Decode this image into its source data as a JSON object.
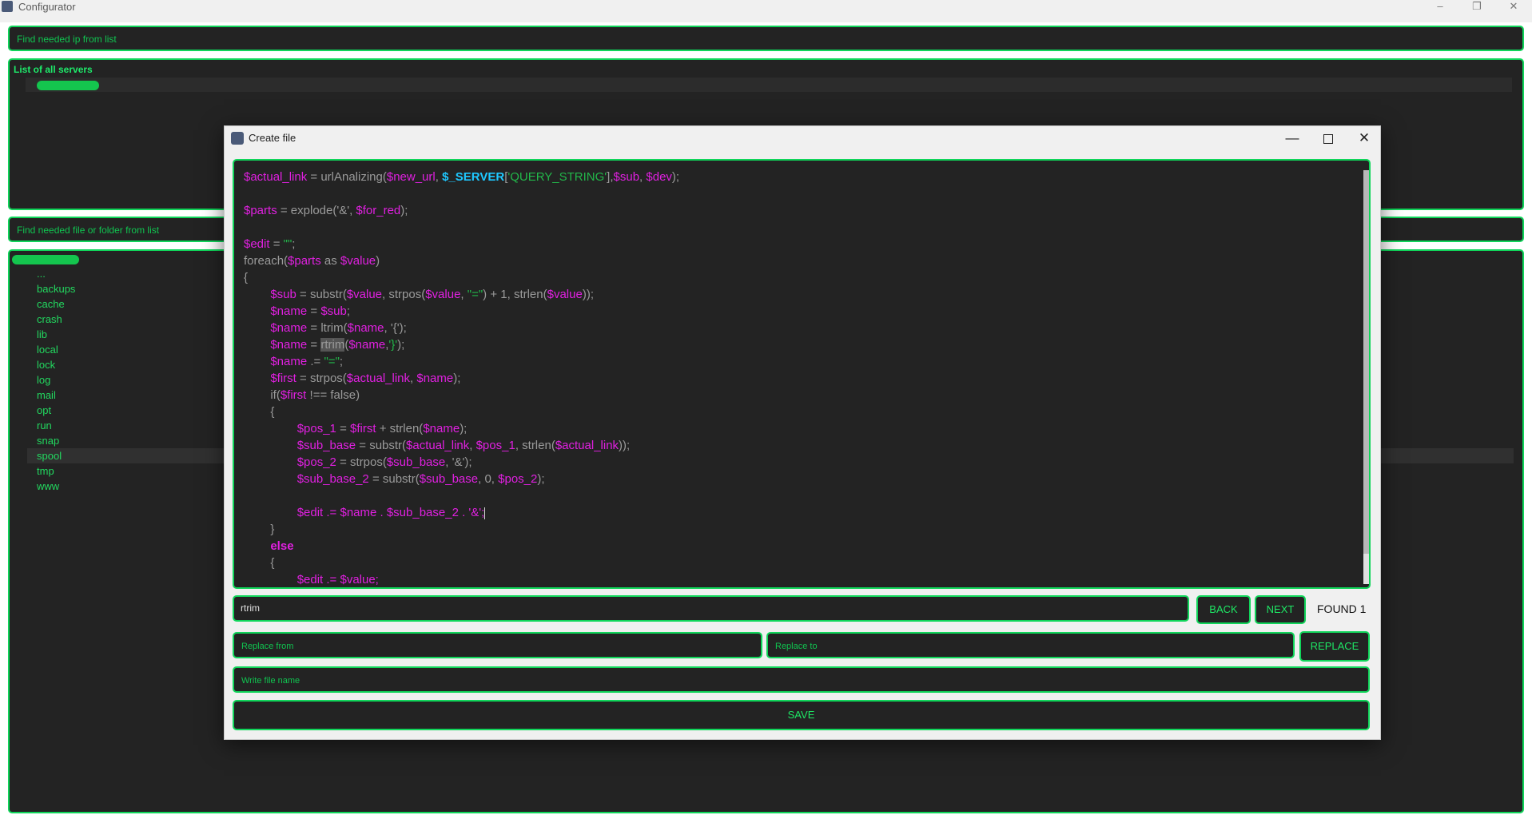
{
  "window": {
    "title": "Configurator",
    "controls": [
      "–",
      "❐",
      "✕"
    ]
  },
  "ip_search": {
    "placeholder": "Find needed ip from list"
  },
  "servers": {
    "title": "List of all servers"
  },
  "file_search": {
    "placeholder": "Find needed file or folder from list"
  },
  "files": {
    "items": [
      "...",
      "backups",
      "cache",
      "crash",
      "lib",
      "local",
      "lock",
      "log",
      "mail",
      "opt",
      "run",
      "snap",
      "spool",
      "tmp",
      "www"
    ],
    "selected": "spool"
  },
  "dialog": {
    "title": "Create file",
    "controls": [
      "—",
      "",
      "✕"
    ],
    "search_value": "rtrim",
    "back_label": "BACK",
    "next_label": "NEXT",
    "found_label": "FOUND 1",
    "replace_from_placeholder": "Replace from",
    "replace_to_placeholder": "Replace to",
    "replace_label": "REPLACE",
    "filename_placeholder": "Write file name",
    "save_label": "SAVE"
  },
  "colors": {
    "accent_green": "#10d55a",
    "panel_dark": "#232323",
    "code_variable": "#e020e0",
    "code_function": "#9a9a9a",
    "code_string": "#22b84a",
    "code_superglobal": "#1ec8ff"
  },
  "code_lines": [
    [
      [
        "v",
        "$actual_link"
      ],
      [
        "f",
        " = urlAnalizing("
      ],
      [
        "v",
        "$new_url"
      ],
      [
        "f",
        ", "
      ],
      [
        "cyan",
        "$_SERVER"
      ],
      [
        "f",
        "["
      ],
      [
        "s",
        "'QUERY_STRING'"
      ],
      [
        "f",
        "],"
      ],
      [
        "v",
        "$sub"
      ],
      [
        "f",
        ", "
      ],
      [
        "v",
        "$dev"
      ],
      [
        "f",
        ");"
      ]
    ],
    [],
    [
      [
        "v",
        "$parts"
      ],
      [
        "f",
        " = explode('&', "
      ],
      [
        "v",
        "$for_red"
      ],
      [
        "f",
        ");"
      ]
    ],
    [],
    [
      [
        "v",
        "$edit"
      ],
      [
        "f",
        " = "
      ],
      [
        "s",
        "\"\""
      ],
      [
        "f",
        ";"
      ]
    ],
    [
      [
        "f",
        "foreach("
      ],
      [
        "v",
        "$parts"
      ],
      [
        "f",
        " as "
      ],
      [
        "v",
        "$value"
      ],
      [
        "f",
        ")"
      ]
    ],
    [
      [
        "f",
        "{"
      ]
    ],
    [
      [
        "f",
        "        "
      ],
      [
        "v",
        "$sub"
      ],
      [
        "f",
        " = substr("
      ],
      [
        "v",
        "$value"
      ],
      [
        "f",
        ", strpos("
      ],
      [
        "v",
        "$value"
      ],
      [
        "f",
        ", "
      ],
      [
        "s",
        "\"=\""
      ],
      [
        "f",
        ") + 1, strlen("
      ],
      [
        "v",
        "$value"
      ],
      [
        "f",
        "));"
      ]
    ],
    [
      [
        "f",
        "        "
      ],
      [
        "v",
        "$name"
      ],
      [
        "f",
        " = "
      ],
      [
        "v",
        "$sub"
      ],
      [
        "f",
        ";"
      ]
    ],
    [
      [
        "f",
        "        "
      ],
      [
        "v",
        "$name"
      ],
      [
        "f",
        " = ltrim("
      ],
      [
        "v",
        "$name"
      ],
      [
        "f",
        ", '{');"
      ]
    ],
    [
      [
        "f",
        "        "
      ],
      [
        "v",
        "$name"
      ],
      [
        "f",
        " = "
      ],
      [
        "hl",
        "rtrim"
      ],
      [
        "f",
        "("
      ],
      [
        "v",
        "$name"
      ],
      [
        "f",
        ","
      ],
      [
        "s",
        "'}'"
      ],
      [
        "f",
        ");"
      ]
    ],
    [
      [
        "f",
        "        "
      ],
      [
        "v",
        "$name"
      ],
      [
        "f",
        " .= "
      ],
      [
        "s",
        "\"=\""
      ],
      [
        "f",
        ";"
      ]
    ],
    [
      [
        "f",
        "        "
      ],
      [
        "v",
        "$first"
      ],
      [
        "f",
        " = strpos("
      ],
      [
        "v",
        "$actual_link"
      ],
      [
        "f",
        ", "
      ],
      [
        "v",
        "$name"
      ],
      [
        "f",
        ");"
      ]
    ],
    [
      [
        "f",
        "        if("
      ],
      [
        "v",
        "$first"
      ],
      [
        "f",
        " !== false)"
      ]
    ],
    [
      [
        "f",
        "        {"
      ]
    ],
    [
      [
        "f",
        "                "
      ],
      [
        "v",
        "$pos_1"
      ],
      [
        "f",
        " = "
      ],
      [
        "v",
        "$first"
      ],
      [
        "f",
        " + strlen("
      ],
      [
        "v",
        "$name"
      ],
      [
        "f",
        ");"
      ]
    ],
    [
      [
        "f",
        "                "
      ],
      [
        "v",
        "$sub_base"
      ],
      [
        "f",
        " = substr("
      ],
      [
        "v",
        "$actual_link"
      ],
      [
        "f",
        ", "
      ],
      [
        "v",
        "$pos_1"
      ],
      [
        "f",
        ", strlen("
      ],
      [
        "v",
        "$actual_link"
      ],
      [
        "f",
        "));"
      ]
    ],
    [
      [
        "f",
        "                "
      ],
      [
        "v",
        "$pos_2"
      ],
      [
        "f",
        " = strpos("
      ],
      [
        "v",
        "$sub_base"
      ],
      [
        "f",
        ", '&');"
      ]
    ],
    [
      [
        "f",
        "                "
      ],
      [
        "v",
        "$sub_base_2"
      ],
      [
        "f",
        " = substr("
      ],
      [
        "v",
        "$sub_base"
      ],
      [
        "f",
        ", 0, "
      ],
      [
        "v",
        "$pos_2"
      ],
      [
        "f",
        ");"
      ]
    ],
    [],
    [
      [
        "f",
        "                "
      ],
      [
        "v",
        "$edit .= $name . $sub_base_2 . '&';"
      ],
      [
        "caret",
        ""
      ]
    ],
    [
      [
        "f",
        "        }"
      ]
    ],
    [
      [
        "f",
        "        "
      ],
      [
        "g",
        "else"
      ]
    ],
    [
      [
        "f",
        "        {"
      ]
    ],
    [
      [
        "f",
        "                "
      ],
      [
        "v",
        "$edit .= $value;"
      ]
    ]
  ]
}
